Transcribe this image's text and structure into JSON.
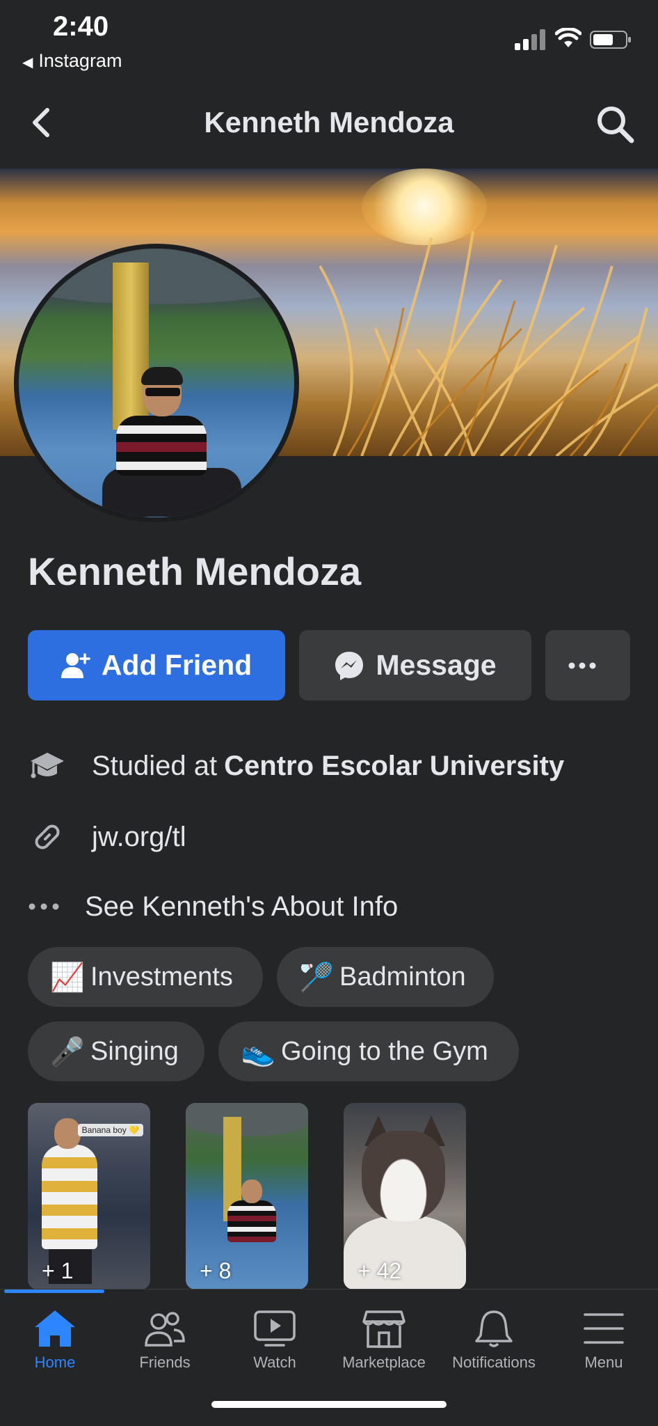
{
  "status_bar": {
    "time": "2:40",
    "back_app": "Instagram"
  },
  "header": {
    "title": "Kenneth Mendoza"
  },
  "profile": {
    "name": "Kenneth Mendoza",
    "add_friend_label": "Add Friend",
    "message_label": "Message"
  },
  "info": {
    "education_prefix": "Studied at",
    "education_school": "Centro Escolar University",
    "website": "jw.org/tl",
    "about_link": "See Kenneth's About Info"
  },
  "hobbies": [
    {
      "emoji": "📈",
      "label": "Investments"
    },
    {
      "emoji": "🏸",
      "label": "Badminton"
    },
    {
      "emoji": "🎤",
      "label": "Singing"
    },
    {
      "emoji": "👟",
      "label": "Going to the Gym"
    }
  ],
  "featured": [
    {
      "count": "+ 1",
      "caption": "Banana boy 💛"
    },
    {
      "count": "+ 8"
    },
    {
      "count": "+ 42"
    }
  ],
  "nav": [
    {
      "label": "Home",
      "icon": "home-icon",
      "active": true
    },
    {
      "label": "Friends",
      "icon": "friends-icon"
    },
    {
      "label": "Watch",
      "icon": "watch-icon"
    },
    {
      "label": "Marketplace",
      "icon": "marketplace-icon"
    },
    {
      "label": "Notifications",
      "icon": "bell-icon"
    },
    {
      "label": "Menu",
      "icon": "menu-icon"
    }
  ],
  "colors": {
    "accent": "#2d6fe0",
    "background": "#242526",
    "surface": "#3a3b3c",
    "active_nav": "#2d86ff"
  }
}
